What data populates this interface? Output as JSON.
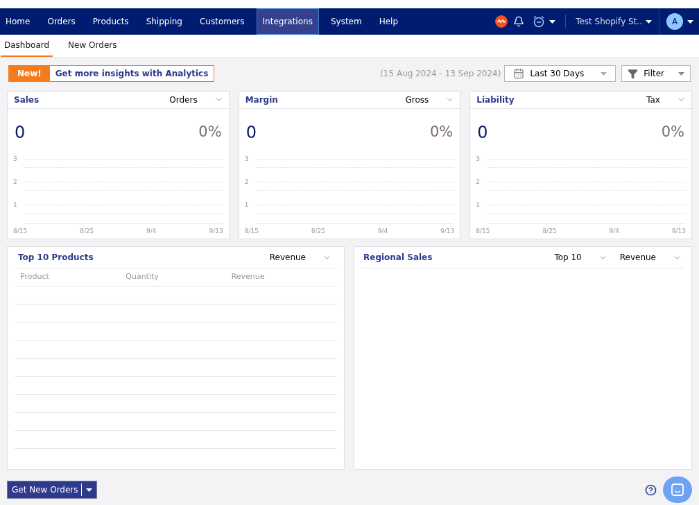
{
  "nav": {
    "items": [
      {
        "label": "Home",
        "selected": false
      },
      {
        "label": "Orders",
        "selected": false
      },
      {
        "label": "Products",
        "selected": false
      },
      {
        "label": "Shipping",
        "selected": false
      },
      {
        "label": "Customers",
        "selected": false
      },
      {
        "label": "Integrations",
        "selected": true
      },
      {
        "label": "System",
        "selected": false
      },
      {
        "label": "Help",
        "selected": false
      }
    ],
    "store": "Test Shopify St..",
    "avatar": "A"
  },
  "subtabs": [
    {
      "label": "Dashboard",
      "selected": true
    },
    {
      "label": "New Orders",
      "selected": false
    }
  ],
  "promo": {
    "badge": "New!",
    "text": "Get more insights with Analytics"
  },
  "date_range": "(15 Aug 2024 - 13 Sep 2024)",
  "period": "Last 30 Days",
  "filter": "Filter",
  "cards": [
    {
      "title": "Sales",
      "metric": "Orders",
      "value": "0",
      "change": "0%",
      "y_ticks": [
        "3",
        "2",
        "1"
      ],
      "x_labels": [
        "8/15",
        "8/25",
        "9/4",
        "9/13"
      ]
    },
    {
      "title": "Margin",
      "metric": "Gross",
      "value": "0",
      "change": "0%",
      "y_ticks": [
        "3",
        "2",
        "1"
      ],
      "x_labels": [
        "8/15",
        "8/25",
        "9/4",
        "9/13"
      ]
    },
    {
      "title": "Liability",
      "metric": "Tax",
      "value": "0",
      "change": "0%",
      "y_ticks": [
        "3",
        "2",
        "1"
      ],
      "x_labels": [
        "8/15",
        "8/25",
        "9/4",
        "9/13"
      ]
    }
  ],
  "top_products": {
    "title": "Top 10 Products",
    "metric": "Revenue",
    "columns": [
      "Product",
      "Quantity",
      "Revenue"
    ]
  },
  "regional_sales": {
    "title": "Regional Sales",
    "scope": "Top 10",
    "metric": "Revenue"
  },
  "get_orders_button": "Get New Orders"
}
